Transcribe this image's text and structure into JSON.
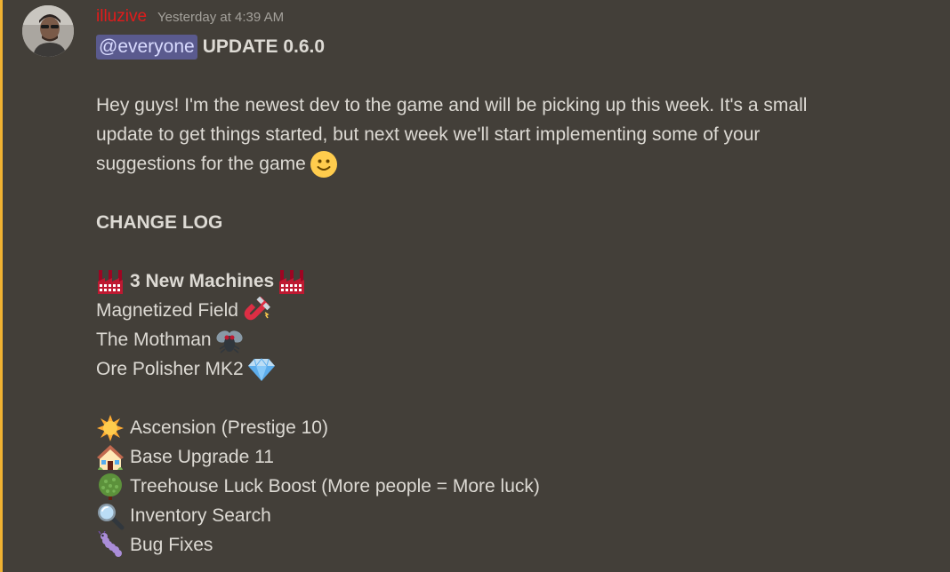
{
  "message": {
    "author": "illuzive",
    "timestamp": "Yesterday at 4:39 AM",
    "mention": "@everyone",
    "title": "UPDATE 0.6.0",
    "intro": [
      "Hey guys! I'm the newest dev to the game and will be picking up this week. It's a small",
      "update to get things started, but next week we'll start implementing some of your",
      "suggestions for the game"
    ],
    "changelog_heading": "CHANGE LOG",
    "machines_heading": "3 New Machines",
    "machines": [
      {
        "label": "Magnetized Field",
        "icon": "magnet-icon"
      },
      {
        "label": "The Mothman",
        "icon": "fly-icon"
      },
      {
        "label": "Ore Polisher MK2",
        "icon": "gem-icon"
      }
    ],
    "features": [
      {
        "label": "Ascension (Prestige 10)",
        "icon": "sun-icon"
      },
      {
        "label": "Base Upgrade 11",
        "icon": "house-icon"
      },
      {
        "label": "Treehouse Luck Boost (More people = More luck)",
        "icon": "tree-icon"
      },
      {
        "label": "Inventory Search",
        "icon": "magnifier-icon"
      },
      {
        "label": "Bug Fixes",
        "icon": "worm-icon"
      }
    ]
  },
  "colors": {
    "background": "#433f39",
    "mention_bar": "#f0b232",
    "username": "#e21b1b",
    "mention_bg": "#5a5a8e"
  }
}
